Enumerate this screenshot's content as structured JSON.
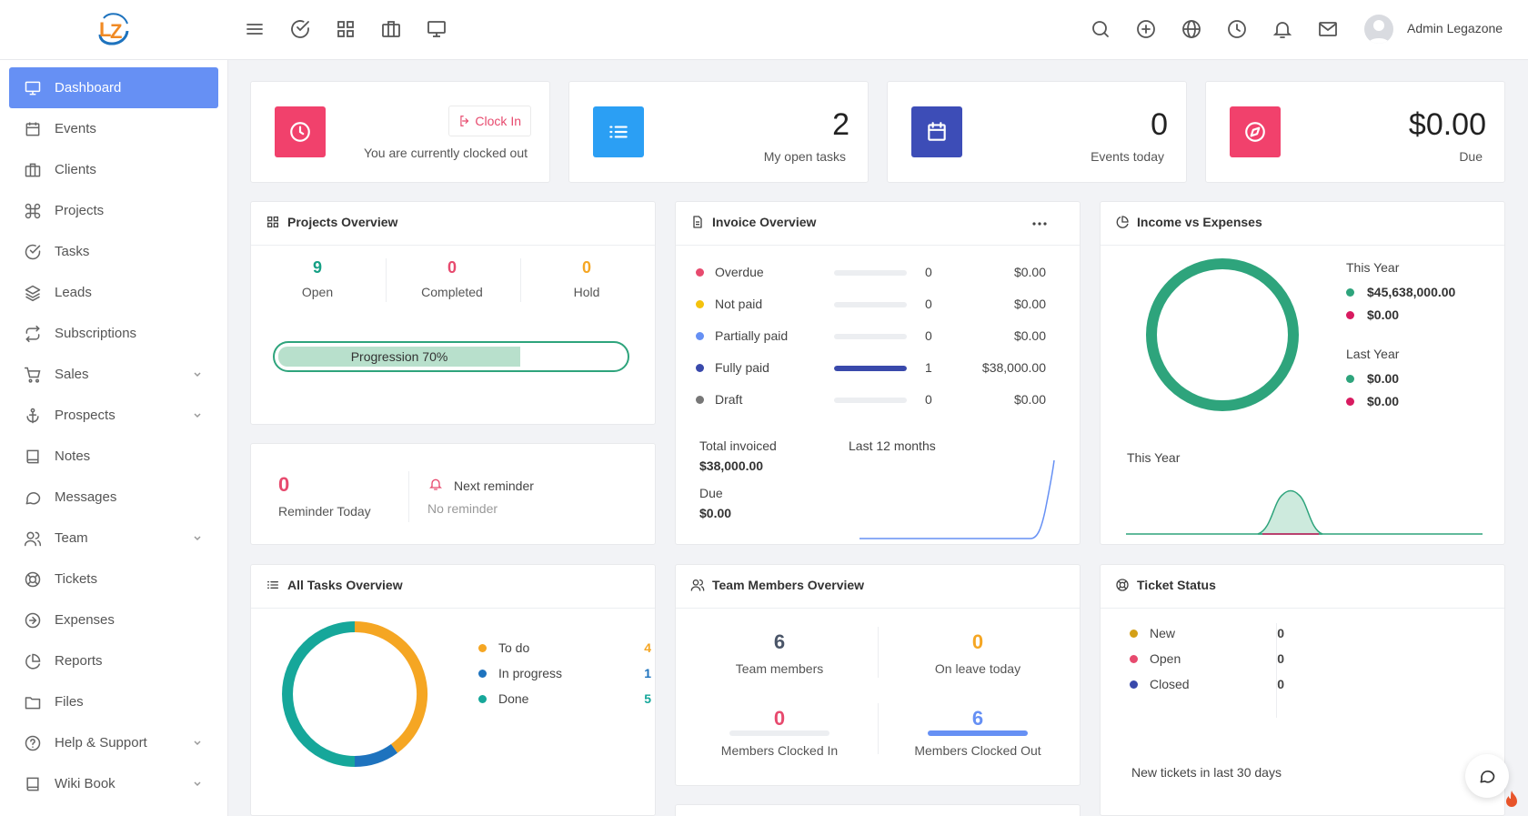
{
  "header": {
    "logo_text": "LZ",
    "left_icons": [
      "menu-icon",
      "check-circle-icon",
      "grid-icon",
      "briefcase-icon",
      "monitor-icon"
    ],
    "right_icons": [
      "search-icon",
      "plus-circle-icon",
      "globe-icon",
      "clock-icon",
      "bell-icon",
      "mail-icon"
    ],
    "user_name": "Admin Legazone"
  },
  "sidebar": {
    "items": [
      {
        "label": "Dashboard",
        "icon": "monitor-icon",
        "active": true
      },
      {
        "label": "Events",
        "icon": "calendar-icon"
      },
      {
        "label": "Clients",
        "icon": "briefcase-icon"
      },
      {
        "label": "Projects",
        "icon": "command-icon"
      },
      {
        "label": "Tasks",
        "icon": "check-circle-icon"
      },
      {
        "label": "Leads",
        "icon": "layers-icon"
      },
      {
        "label": "Subscriptions",
        "icon": "repeat-icon"
      },
      {
        "label": "Sales",
        "icon": "cart-icon",
        "has_submenu": true
      },
      {
        "label": "Prospects",
        "icon": "anchor-icon",
        "has_submenu": true
      },
      {
        "label": "Notes",
        "icon": "book-icon"
      },
      {
        "label": "Messages",
        "icon": "message-icon"
      },
      {
        "label": "Team",
        "icon": "users-icon",
        "has_submenu": true
      },
      {
        "label": "Tickets",
        "icon": "life-buoy-icon"
      },
      {
        "label": "Expenses",
        "icon": "arrow-right-circle-icon"
      },
      {
        "label": "Reports",
        "icon": "pie-chart-icon"
      },
      {
        "label": "Files",
        "icon": "folder-icon"
      },
      {
        "label": "Help & Support",
        "icon": "help-circle-icon",
        "has_submenu": true
      },
      {
        "label": "Wiki Book",
        "icon": "book-icon",
        "has_submenu": true
      }
    ]
  },
  "clock_card": {
    "button_label": "Clock In",
    "status_text": "You are currently clocked out",
    "color": "#f1416c"
  },
  "tasks_card": {
    "value": "2",
    "label": "My open tasks",
    "color": "#2b9ff4"
  },
  "events_card": {
    "value": "0",
    "label": "Events today",
    "color": "#3d4db7"
  },
  "due_card": {
    "value": "$0.00",
    "label": "Due",
    "color": "#f1416c"
  },
  "projects_overview": {
    "title": "Projects Overview",
    "stats": [
      {
        "value": "9",
        "label": "Open",
        "color": "#16a085"
      },
      {
        "value": "0",
        "label": "Completed",
        "color": "#e74a6e"
      },
      {
        "value": "0",
        "label": "Hold",
        "color": "#f5a623"
      }
    ],
    "progress_label": "Progression 70%",
    "progress": 0.7
  },
  "reminder": {
    "count": "0",
    "count_label": "Reminder Today",
    "next_title": "Next reminder",
    "next_value": "No reminder"
  },
  "invoice_overview": {
    "title": "Invoice Overview",
    "rows": [
      {
        "label": "Overdue",
        "color": "#e74a6e",
        "count": "0",
        "amount": "$0.00",
        "fill": 0
      },
      {
        "label": "Not paid",
        "color": "#f4c20d",
        "count": "0",
        "amount": "$0.00",
        "fill": 0
      },
      {
        "label": "Partially paid",
        "color": "#6690f4",
        "count": "0",
        "amount": "$0.00",
        "fill": 0
      },
      {
        "label": "Fully paid",
        "color": "#3949ab",
        "count": "1",
        "amount": "$38,000.00",
        "fill": 1
      },
      {
        "label": "Draft",
        "color": "#777777",
        "count": "0",
        "amount": "$0.00",
        "fill": 0
      }
    ],
    "total_label": "Total invoiced",
    "total_value": "$38,000.00",
    "due_label": "Due",
    "due_value": "$0.00",
    "chart_label": "Last 12 months"
  },
  "income_expenses": {
    "title": "Income vs Expenses",
    "this_year_label": "This Year",
    "this_year_income": "$45,638,000.00",
    "this_year_expense": "$0.00",
    "last_year_label": "Last Year",
    "last_year_income": "$0.00",
    "last_year_expense": "$0.00",
    "chart_label": "This Year",
    "income_color": "#2ea47c",
    "expense_color": "#d81b60"
  },
  "tasks_overview": {
    "title": "All Tasks Overview",
    "items": [
      {
        "label": "To do",
        "value": "4",
        "color": "#f5a623"
      },
      {
        "label": "In progress",
        "value": "1",
        "color": "#1e73be"
      },
      {
        "label": "Done",
        "value": "5",
        "color": "#16a79a"
      }
    ]
  },
  "team_overview": {
    "title": "Team Members Overview",
    "cells": [
      {
        "value": "6",
        "label": "Team members",
        "color": "#4a5568"
      },
      {
        "value": "0",
        "label": "On leave today",
        "color": "#f5a623"
      },
      {
        "value": "0",
        "label": "Members Clocked In",
        "color": "#e74a6e"
      },
      {
        "value": "6",
        "label": "Members Clocked Out",
        "color": "#6690f4"
      }
    ]
  },
  "ticket_status": {
    "title": "Ticket Status",
    "items": [
      {
        "label": "New",
        "value": "0",
        "color": "#d4a017"
      },
      {
        "label": "Open",
        "value": "0",
        "color": "#e74a6e"
      },
      {
        "label": "Closed",
        "value": "0",
        "color": "#3949ab"
      }
    ],
    "footer": "New tickets in last 30 days"
  }
}
